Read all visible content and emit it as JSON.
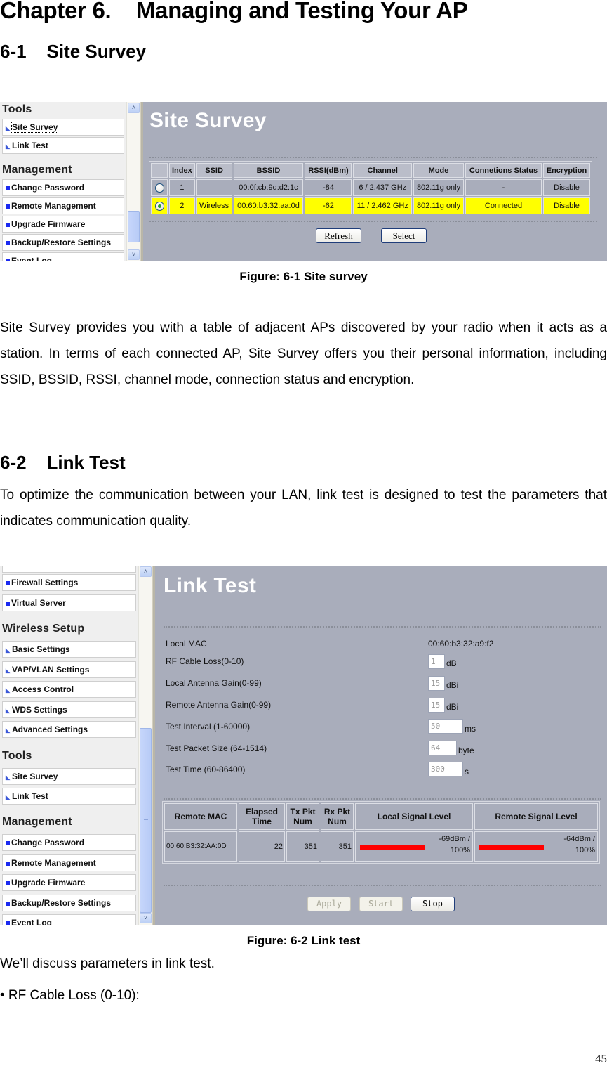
{
  "document": {
    "chapter_title": "Chapter 6.    Managing and Testing Your AP",
    "section1_title": "6-1    Site Survey",
    "figure1_caption": "Figure: 6-1 Site survey",
    "section1_paragraph": "Site Survey provides you with a table of adjacent APs discovered by your radio when it acts as a station. In terms of each connected AP, Site Survey offers you their personal information, including SSID, BSSID, RSSI, channel mode, connection status and encryption.",
    "section2_title": "6-2    Link Test",
    "section2_paragraph": "To optimize the communication between your LAN, link test is designed to test the parameters that indicates communication quality.",
    "figure2_caption": "Figure: 6-2 Link test",
    "discuss_line": "We’ll discuss parameters in link test.",
    "bullet_item": "• RF Cable Loss (0-10):",
    "page_number": "45"
  },
  "figure1": {
    "sidebar": {
      "tools_heading": "Tools",
      "tools_items": [
        {
          "label": "Site Survey",
          "icon": "wireless-icon"
        },
        {
          "label": "Link Test",
          "icon": "wireless-icon"
        }
      ],
      "management_heading": "Management",
      "management_items": [
        {
          "label": "Change Password",
          "icon": "square-bullet-icon"
        },
        {
          "label": "Remote Management",
          "icon": "square-bullet-icon"
        },
        {
          "label": "Upgrade Firmware",
          "icon": "square-bullet-icon"
        },
        {
          "label": "Backup/Restore Settings",
          "icon": "square-bullet-icon"
        },
        {
          "label": "Event Log",
          "icon": "square-bullet-icon"
        }
      ]
    },
    "page_heading": "Site Survey",
    "table": {
      "headers": [
        "",
        "Index",
        "SSID",
        "BSSID",
        "RSSI(dBm)",
        "Channel",
        "Mode",
        "Connetions Status",
        "Encryption"
      ],
      "rows": [
        {
          "selected": false,
          "index": "1",
          "ssid": "",
          "bssid": "00:0f:cb:9d:d2:1c",
          "rssi": "-84",
          "channel": "6 / 2.437 GHz",
          "mode": "802.11g only",
          "status": "-",
          "encryption": "Disable"
        },
        {
          "selected": true,
          "index": "2",
          "ssid": "Wireless",
          "bssid": "00:60:b3:32:aa:0d",
          "rssi": "-62",
          "channel": "11 / 2.462 GHz",
          "mode": "802.11g only",
          "status": "Connected",
          "encryption": "Disable"
        }
      ],
      "highlight_color": "#ffff00"
    },
    "buttons": {
      "refresh": "Refresh",
      "select": "Select"
    }
  },
  "figure2": {
    "sidebar": {
      "top_items": [
        {
          "label": "Firewall Settings",
          "icon": "square-bullet-icon"
        },
        {
          "label": "Virtual Server",
          "icon": "square-bullet-icon"
        }
      ],
      "wireless_heading": "Wireless Setup",
      "wireless_items": [
        {
          "label": "Basic Settings",
          "icon": "wireless-icon"
        },
        {
          "label": "VAP/VLAN Settings",
          "icon": "wireless-icon"
        },
        {
          "label": "Access Control",
          "icon": "wireless-icon"
        },
        {
          "label": "WDS Settings",
          "icon": "wireless-icon"
        },
        {
          "label": "Advanced Settings",
          "icon": "wireless-icon"
        }
      ],
      "tools_heading": "Tools",
      "tools_items": [
        {
          "label": "Site Survey",
          "icon": "wireless-icon"
        },
        {
          "label": "Link Test",
          "icon": "wireless-icon"
        }
      ],
      "management_heading": "Management",
      "management_items": [
        {
          "label": "Change Password",
          "icon": "square-bullet-icon"
        },
        {
          "label": "Remote Management",
          "icon": "square-bullet-icon"
        },
        {
          "label": "Upgrade Firmware",
          "icon": "square-bullet-icon"
        },
        {
          "label": "Backup/Restore Settings",
          "icon": "square-bullet-icon"
        },
        {
          "label": "Event Log",
          "icon": "square-bullet-icon"
        }
      ]
    },
    "page_heading": "Link Test",
    "form": {
      "local_mac_label": "Local MAC",
      "local_mac_value": "00:60:b3:32:a9:f2",
      "fields": [
        {
          "label": "RF Cable Loss(0-10)",
          "value": "1",
          "unit": "dB"
        },
        {
          "label": "Local Antenna Gain(0-99)",
          "value": "15",
          "unit": "dBi"
        },
        {
          "label": "Remote Antenna Gain(0-99)",
          "value": "15",
          "unit": "dBi"
        },
        {
          "label": "Test Interval (1-60000)",
          "value": "50",
          "unit": "ms"
        },
        {
          "label": "Test Packet Size (64-1514)",
          "value": "64",
          "unit": "byte"
        },
        {
          "label": "Test Time (60-86400)",
          "value": "300",
          "unit": "s"
        }
      ]
    },
    "results": {
      "headers": {
        "remote_mac": "Remote MAC",
        "elapsed_1": "Elapsed",
        "elapsed_2": "Time",
        "tx_1": "Tx Pkt",
        "tx_2": "Num",
        "rx_1": "Rx Pkt",
        "rx_2": "Num",
        "local_signal": "Local Signal Level",
        "remote_signal": "Remote Signal Level"
      },
      "row": {
        "remote_mac": "00:60:B3:32:AA:0D",
        "elapsed": "22",
        "tx": "351",
        "rx": "351",
        "local_dbm": "-69dBm /",
        "local_pct": "100%",
        "local_level": 1.0,
        "remote_dbm": "-64dBm /",
        "remote_pct": "100%",
        "remote_level": 1.0
      },
      "bar_color": "#ff0000"
    },
    "buttons": {
      "apply": "Apply",
      "start": "Start",
      "stop": "Stop"
    }
  }
}
